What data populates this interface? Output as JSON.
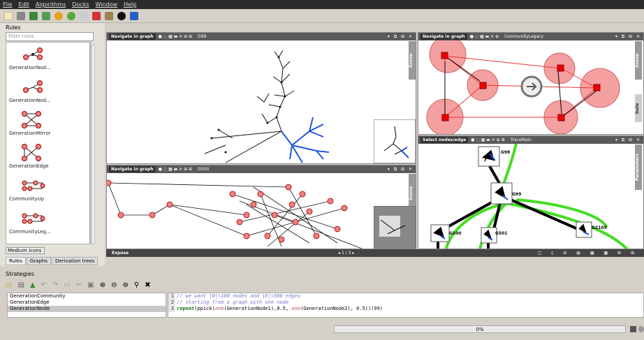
{
  "menu": [
    "File",
    "Edit",
    "Algorithms",
    "Docks",
    "Window",
    "Help"
  ],
  "rules": {
    "title": "Rules",
    "filter_placeholder": "Filter rules",
    "items": [
      "GenerationNod...",
      "GenerationNod...",
      "GenerationMirror",
      "GenerationEdge",
      "CommunityUp",
      "CommunityLeg...",
      ""
    ],
    "icon_size": "Medium icons",
    "tabs": [
      "Rules",
      "Graphs",
      "Derivation trees"
    ]
  },
  "views": {
    "v1": {
      "mode": "Navigate in graph",
      "name": "G99",
      "side": "Scene"
    },
    "v2": {
      "mode": "Navigate in graph",
      "name": "CommunityLegacy",
      "side": "Scene",
      "side2": "bute"
    },
    "v3": {
      "mode": "Navigate in graph",
      "name": "G500",
      "side": "Scene"
    },
    "v4": {
      "mode": "Select nodes/edge",
      "name": "TraceMain",
      "side": "Parameters"
    }
  },
  "trace_nodes": [
    "G98",
    "G99",
    "G100",
    "G501",
    "G2105"
  ],
  "expose": {
    "label": "Expose",
    "pager": "◂  1 / 3  ▸"
  },
  "strategies": {
    "title": "Strategies",
    "items": [
      "GenerationCommunity",
      "GenerationEdge",
      "GenerationNode"
    ],
    "selected": 2
  },
  "code": {
    "line1": "// we want |N|<100 nodes and |E|>500 edges",
    "line2": "// starting from a graph with one node",
    "l3_kw": "repeat",
    "l3_a": "(ppick(",
    "l3_one1": "one",
    "l3_b": "(GenerationNode1),0.5, ",
    "l3_one2": "one",
    "l3_c": "(GenerationNode2), 0.5))(99)"
  },
  "progress": "0%",
  "colors": {
    "blue": "#2255dd",
    "green": "#44dd22",
    "node": "#f08080"
  }
}
